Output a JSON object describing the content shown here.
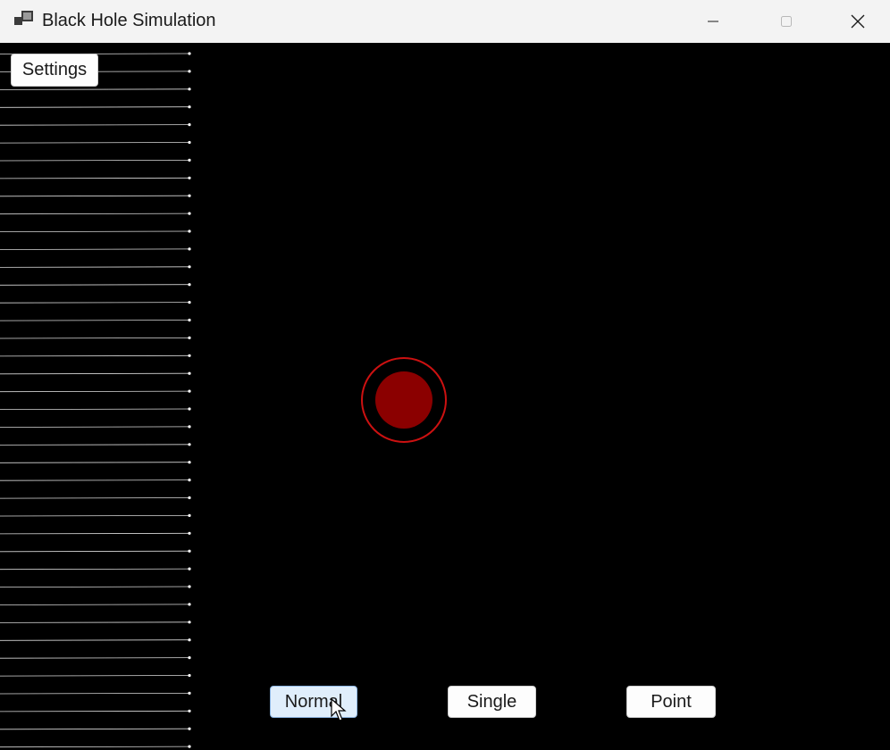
{
  "window": {
    "title": "Black Hole Simulation",
    "app_icon": "app-window-icon",
    "controls": [
      "minimize-icon",
      "maximize-icon",
      "close-icon"
    ]
  },
  "toolbar": {
    "settings_label": "Settings"
  },
  "modes": {
    "normal_label": "Normal",
    "single_label": "Single",
    "point_label": "Point",
    "active": "Normal"
  },
  "simulation": {
    "ray_count": 40,
    "ray_color": "#ffffff",
    "ray_head_color": "#ffffff",
    "event_horizon_color": "#8b0000",
    "photon_sphere_color": "#cc1111",
    "background_color": "#000000"
  }
}
